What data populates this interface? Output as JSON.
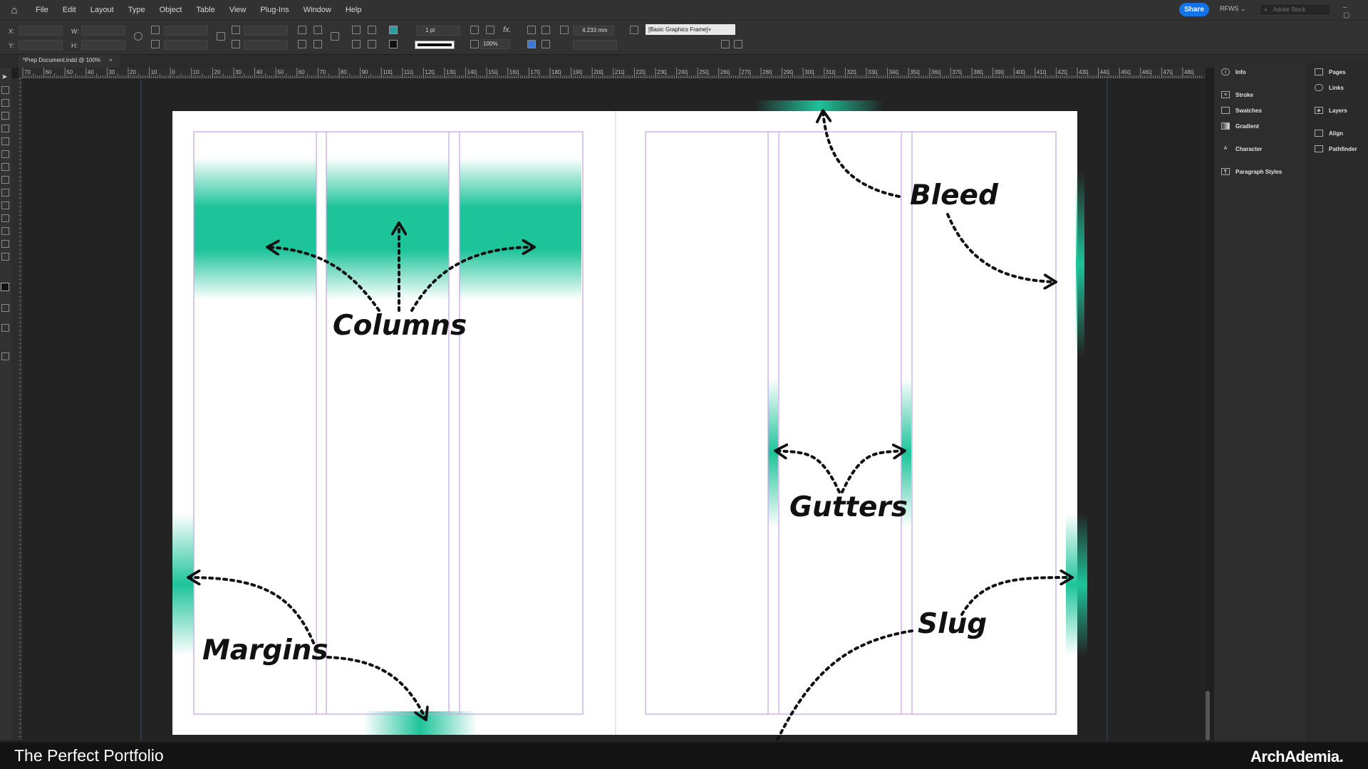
{
  "menubar": {
    "items": [
      "File",
      "Edit",
      "Layout",
      "Type",
      "Object",
      "Table",
      "View",
      "Plug-Ins",
      "Window",
      "Help"
    ],
    "share_label": "Share",
    "workspace": "RFWS",
    "search_placeholder": "Adobe Stock"
  },
  "controlbar": {
    "x_label": "X:",
    "y_label": "Y:",
    "w_label": "W:",
    "h_label": "H:",
    "stroke_weight": "1 pt",
    "opacity": "100%",
    "dimension": "4.233 mm",
    "object_style": "[Basic Graphics Frame]+"
  },
  "document": {
    "tab_title": "*Prep Document.indd @ 100%",
    "ruler_labels": [
      "70",
      "60",
      "50",
      "40",
      "30",
      "20",
      "10",
      "0",
      "10",
      "20",
      "30",
      "40",
      "50",
      "60",
      "70",
      "80",
      "90",
      "100",
      "110",
      "120",
      "130",
      "140",
      "150",
      "160",
      "170",
      "180",
      "190",
      "200",
      "210",
      "220",
      "230",
      "240",
      "250",
      "260",
      "270",
      "280",
      "290",
      "300",
      "310",
      "320",
      "330",
      "340",
      "350",
      "360",
      "370",
      "380",
      "390",
      "400",
      "410",
      "420",
      "430",
      "440",
      "450",
      "460",
      "470",
      "480"
    ]
  },
  "annotations": {
    "columns": "Columns",
    "margins": "Margins",
    "bleed": "Bleed",
    "gutters": "Gutters",
    "slug": "Slug"
  },
  "panels": {
    "left": [
      {
        "label": "Info",
        "icon": "info-icon"
      },
      {
        "label": "Stroke",
        "icon": "stroke-icon"
      },
      {
        "label": "Swatches",
        "icon": "swatches-icon"
      },
      {
        "label": "Gradient",
        "icon": "gradient-icon"
      },
      {
        "label": "Character",
        "icon": "character-icon"
      },
      {
        "label": "Paragraph Styles",
        "icon": "paragraph-styles-icon"
      }
    ],
    "right": [
      {
        "label": "Pages",
        "icon": "pages-icon"
      },
      {
        "label": "Links",
        "icon": "links-icon"
      },
      {
        "label": "Layers",
        "icon": "layers-icon"
      },
      {
        "label": "Align",
        "icon": "align-icon"
      },
      {
        "label": "Pathfinder",
        "icon": "pathfinder-icon"
      }
    ]
  },
  "footer": {
    "title": "The Perfect Portfolio",
    "brand": "ArchAdemia."
  },
  "colors": {
    "accent_teal": "#1dc49a",
    "guide_purple": "#b18ad6",
    "share_blue": "#1473e6"
  }
}
